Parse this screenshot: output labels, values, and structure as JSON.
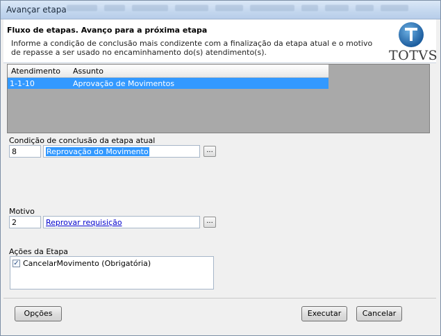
{
  "window": {
    "title": "Avançar etapa"
  },
  "header": {
    "title": "Fluxo de etapas. Avanço para a próxima etapa",
    "description": "Informe a condição de conclusão mais condizente com a finalização da etapa atual e o motivo de repasse a ser usado no encaminhamento do(s) atendimento(s).",
    "logo_text": "TOTVS"
  },
  "grid": {
    "columns": [
      "Atendimento",
      "Assunto"
    ],
    "rows": [
      {
        "atendimento": "1-1-10",
        "assunto": "Aprovação de Movimentos",
        "selected": true
      }
    ]
  },
  "condicao": {
    "label": "Condição de conclusão da etapa atual",
    "code": "8",
    "value": "Reprovação do Movimento",
    "lookup_label": "..."
  },
  "motivo": {
    "label": "Motivo",
    "code": "2",
    "value": "Reprovar requisição",
    "lookup_label": "..."
  },
  "acoes": {
    "label": "Ações da Etapa",
    "items": [
      {
        "label": "CancelarMovimento (Obrigatória)",
        "checked": true,
        "mark": "✓"
      }
    ]
  },
  "buttons": {
    "options": "Opções",
    "execute": "Executar",
    "cancel": "Cancelar"
  },
  "colors": {
    "selection": "#3399ff",
    "grid_background": "#a9a9a9",
    "link": "#0000cc"
  }
}
